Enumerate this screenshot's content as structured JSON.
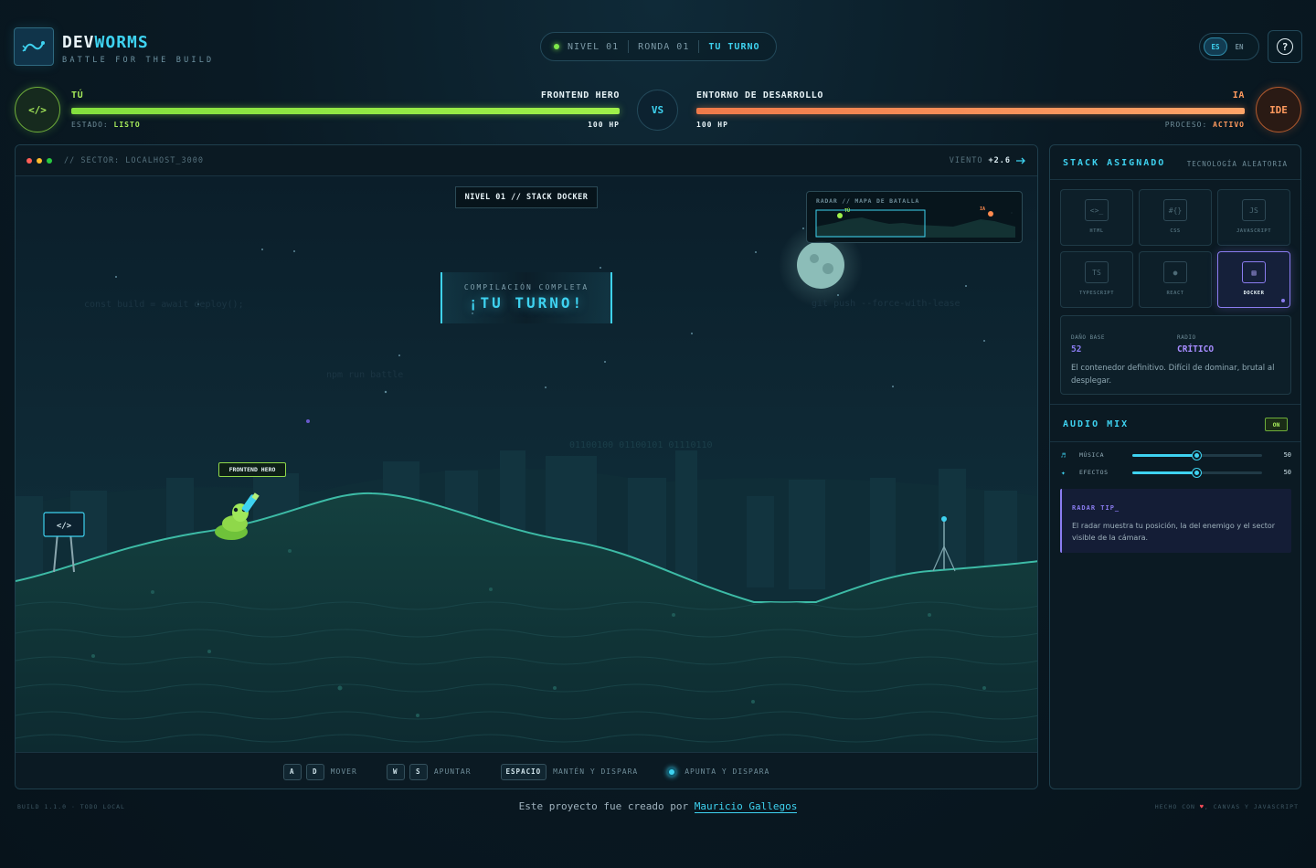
{
  "header": {
    "brand_part1": "DEV",
    "brand_part2": "WORMS",
    "tagline": "BATTLE FOR THE BUILD",
    "level": "NIVEL 01",
    "round": "RONDA 01",
    "turn": "TU TURNO",
    "lang_es": "ES",
    "lang_en": "EN",
    "help": "?"
  },
  "player": {
    "avatar": "</>",
    "tag": "TÚ",
    "name": "FRONTEND HERO",
    "hp_text": "100 HP",
    "hp_fraction": 1.0,
    "state_label": "ESTADO:",
    "state_value": "LISTO"
  },
  "versus": "VS",
  "enemy": {
    "avatar": "IDE",
    "tag": "IA",
    "name": "ENTORNO DE DESARROLLO",
    "hp_text": "100 HP",
    "hp_fraction": 1.0,
    "process_label": "PROCESO:",
    "process_value": "ACTIVO"
  },
  "game": {
    "sector": "// SECTOR: LOCALHOST_3000",
    "wind_label": "VIENTO",
    "wind_value": "+2.6",
    "level_tag": "NIVEL 01 // STACK DOCKER",
    "banner_sub": "COMPILACIÓN COMPLETA",
    "banner_main": "¡TU TURNO!",
    "radar_title": "RADAR // MAPA DE BATALLA",
    "radar_player": "TÚ",
    "radar_enemy": "IA",
    "ghost_code": [
      "const build = await deploy();",
      "npm run battle",
      "git push --force-with-lease",
      "01100100 01100101 01110110"
    ],
    "unit_name": "FRONTEND HERO",
    "sign_icon": "</>"
  },
  "controls": [
    {
      "keys": [
        "A",
        "D"
      ],
      "label": "MOVER"
    },
    {
      "keys": [
        "W",
        "S"
      ],
      "label": "APUNTAR"
    },
    {
      "keys": [
        "ESPACIO"
      ],
      "label": "MANTÉN Y DISPARA"
    },
    {
      "keys": [],
      "label": "APUNTA Y DISPARA"
    }
  ],
  "side": {
    "stack_title": "STACK ASIGNADO",
    "stack_sub": "TECNOLOGÍA ALEATORIA",
    "techs": [
      {
        "icon": "<>_",
        "name": "HTML"
      },
      {
        "icon": "#{}",
        "name": "CSS"
      },
      {
        "icon": "JS",
        "name": "JAVASCRIPT"
      },
      {
        "icon": "TS",
        "name": "TYPESCRIPT"
      },
      {
        "icon": "●",
        "name": "REACT"
      },
      {
        "icon": "▤",
        "name": "DOCKER"
      }
    ],
    "damage_label": "DAÑO BASE",
    "damage_value": "52",
    "radius_label": "RADIO",
    "radius_value": "CRÍTICO",
    "description": "El contenedor definitivo. Difícil de dominar, brutal al desplegar.",
    "audio_title": "AUDIO MIX",
    "audio_on": "ON",
    "music_label": "MÚSICA",
    "music_value": "50",
    "effects_label": "EFECTOS",
    "effects_value": "50",
    "tip_title": "RADAR TIP_",
    "tip_text": "El radar muestra tu posición, la del enemigo y el sector visible de la cámara."
  },
  "footer": {
    "build": "BUILD 1.1.0 · TODO LOCAL",
    "credit_prefix": "Este proyecto fue creado por",
    "credit_name": "Mauricio Gallegos",
    "made_prefix": "HECHO CON",
    "made_suffix": ", CANVAS Y JAVASCRIPT"
  },
  "colors": {
    "accent": "#3ed2f0",
    "player": "#9ff04a",
    "enemy": "#ffa468",
    "selected": "#8a7cf0"
  }
}
